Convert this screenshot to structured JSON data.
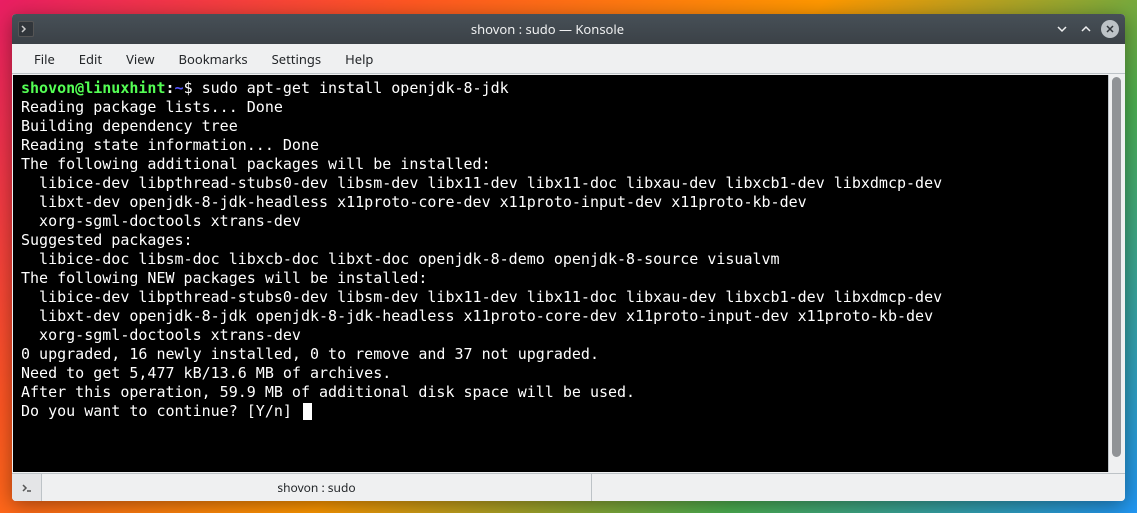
{
  "window": {
    "title": "shovon : sudo — Konsole"
  },
  "menubar": {
    "items": [
      "File",
      "Edit",
      "View",
      "Bookmarks",
      "Settings",
      "Help"
    ]
  },
  "terminal": {
    "prompt": {
      "user": "shovon",
      "at": "@",
      "host": "linuxhint",
      "colon": ":",
      "path": "~",
      "dollar": "$"
    },
    "command": "sudo apt-get install openjdk-8-jdk",
    "output_lines": [
      "Reading package lists... Done",
      "Building dependency tree       ",
      "Reading state information... Done",
      "The following additional packages will be installed:",
      "  libice-dev libpthread-stubs0-dev libsm-dev libx11-dev libx11-doc libxau-dev libxcb1-dev libxdmcp-dev",
      "  libxt-dev openjdk-8-jdk-headless x11proto-core-dev x11proto-input-dev x11proto-kb-dev",
      "  xorg-sgml-doctools xtrans-dev",
      "Suggested packages:",
      "  libice-doc libsm-doc libxcb-doc libxt-doc openjdk-8-demo openjdk-8-source visualvm",
      "The following NEW packages will be installed:",
      "  libice-dev libpthread-stubs0-dev libsm-dev libx11-dev libx11-doc libxau-dev libxcb1-dev libxdmcp-dev",
      "  libxt-dev openjdk-8-jdk openjdk-8-jdk-headless x11proto-core-dev x11proto-input-dev x11proto-kb-dev",
      "  xorg-sgml-doctools xtrans-dev",
      "0 upgraded, 16 newly installed, 0 to remove and 37 not upgraded.",
      "Need to get 5,477 kB/13.6 MB of archives.",
      "After this operation, 59.9 MB of additional disk space will be used.",
      "Do you want to continue? [Y/n] "
    ]
  },
  "tabbar": {
    "tab_label": "shovon : sudo"
  }
}
